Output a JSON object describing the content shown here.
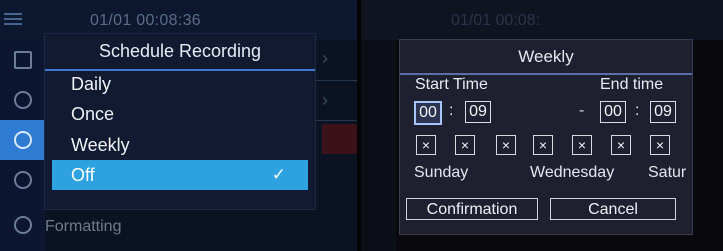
{
  "left": {
    "timestamp": "01/01 00:08:36",
    "dialog": {
      "title": "Schedule Recording",
      "options": [
        "Daily",
        "Once",
        "Weekly",
        "Off"
      ],
      "selected_check": "✓"
    },
    "bottom_item": "Formatting"
  },
  "right": {
    "timestamp": "01/01 00:08:",
    "dialog": {
      "title": "Weekly",
      "start_label": "Start Time",
      "end_label": "End time",
      "start_hour": "00",
      "start_min": "09",
      "end_hour": "00",
      "end_min": "09",
      "colon": ":",
      "dash": "-",
      "day_mark": "×",
      "days_visible": [
        "Sunday",
        "Wednesday",
        "Satur"
      ],
      "confirm_label": "Confirmation",
      "cancel_label": "Cancel"
    }
  },
  "colors": {
    "accent_blue": "#2ea1e0",
    "sidebar_active": "#2f7bd1"
  }
}
